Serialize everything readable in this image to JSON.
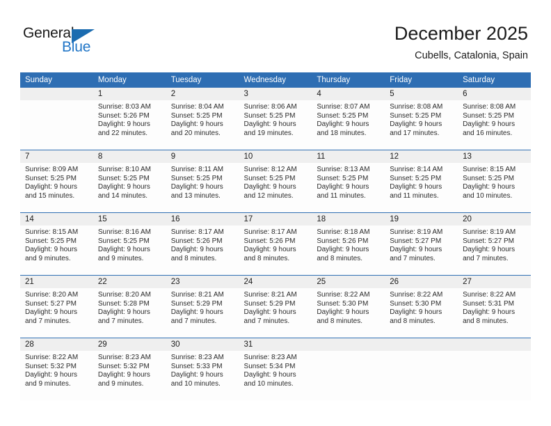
{
  "brand": {
    "name_top": "General",
    "name_bottom": "Blue",
    "accent_color": "#1b6cb0"
  },
  "header": {
    "title": "December 2025",
    "subtitle": "Cubells, Catalonia, Spain"
  },
  "theme": {
    "header_blue": "#2e6eb3",
    "daynum_gray": "#efefef",
    "cell_white": "#fdfdfd"
  },
  "weekday_headers": [
    "Sunday",
    "Monday",
    "Tuesday",
    "Wednesday",
    "Thursday",
    "Friday",
    "Saturday"
  ],
  "weeks": [
    [
      {
        "day": "",
        "sunrise": "",
        "sunset": "",
        "daylight_1": "",
        "daylight_2": ""
      },
      {
        "day": "1",
        "sunrise": "Sunrise: 8:03 AM",
        "sunset": "Sunset: 5:26 PM",
        "daylight_1": "Daylight: 9 hours",
        "daylight_2": "and 22 minutes."
      },
      {
        "day": "2",
        "sunrise": "Sunrise: 8:04 AM",
        "sunset": "Sunset: 5:25 PM",
        "daylight_1": "Daylight: 9 hours",
        "daylight_2": "and 20 minutes."
      },
      {
        "day": "3",
        "sunrise": "Sunrise: 8:06 AM",
        "sunset": "Sunset: 5:25 PM",
        "daylight_1": "Daylight: 9 hours",
        "daylight_2": "and 19 minutes."
      },
      {
        "day": "4",
        "sunrise": "Sunrise: 8:07 AM",
        "sunset": "Sunset: 5:25 PM",
        "daylight_1": "Daylight: 9 hours",
        "daylight_2": "and 18 minutes."
      },
      {
        "day": "5",
        "sunrise": "Sunrise: 8:08 AM",
        "sunset": "Sunset: 5:25 PM",
        "daylight_1": "Daylight: 9 hours",
        "daylight_2": "and 17 minutes."
      },
      {
        "day": "6",
        "sunrise": "Sunrise: 8:08 AM",
        "sunset": "Sunset: 5:25 PM",
        "daylight_1": "Daylight: 9 hours",
        "daylight_2": "and 16 minutes."
      }
    ],
    [
      {
        "day": "7",
        "sunrise": "Sunrise: 8:09 AM",
        "sunset": "Sunset: 5:25 PM",
        "daylight_1": "Daylight: 9 hours",
        "daylight_2": "and 15 minutes."
      },
      {
        "day": "8",
        "sunrise": "Sunrise: 8:10 AM",
        "sunset": "Sunset: 5:25 PM",
        "daylight_1": "Daylight: 9 hours",
        "daylight_2": "and 14 minutes."
      },
      {
        "day": "9",
        "sunrise": "Sunrise: 8:11 AM",
        "sunset": "Sunset: 5:25 PM",
        "daylight_1": "Daylight: 9 hours",
        "daylight_2": "and 13 minutes."
      },
      {
        "day": "10",
        "sunrise": "Sunrise: 8:12 AM",
        "sunset": "Sunset: 5:25 PM",
        "daylight_1": "Daylight: 9 hours",
        "daylight_2": "and 12 minutes."
      },
      {
        "day": "11",
        "sunrise": "Sunrise: 8:13 AM",
        "sunset": "Sunset: 5:25 PM",
        "daylight_1": "Daylight: 9 hours",
        "daylight_2": "and 11 minutes."
      },
      {
        "day": "12",
        "sunrise": "Sunrise: 8:14 AM",
        "sunset": "Sunset: 5:25 PM",
        "daylight_1": "Daylight: 9 hours",
        "daylight_2": "and 11 minutes."
      },
      {
        "day": "13",
        "sunrise": "Sunrise: 8:15 AM",
        "sunset": "Sunset: 5:25 PM",
        "daylight_1": "Daylight: 9 hours",
        "daylight_2": "and 10 minutes."
      }
    ],
    [
      {
        "day": "14",
        "sunrise": "Sunrise: 8:15 AM",
        "sunset": "Sunset: 5:25 PM",
        "daylight_1": "Daylight: 9 hours",
        "daylight_2": "and 9 minutes."
      },
      {
        "day": "15",
        "sunrise": "Sunrise: 8:16 AM",
        "sunset": "Sunset: 5:25 PM",
        "daylight_1": "Daylight: 9 hours",
        "daylight_2": "and 9 minutes."
      },
      {
        "day": "16",
        "sunrise": "Sunrise: 8:17 AM",
        "sunset": "Sunset: 5:26 PM",
        "daylight_1": "Daylight: 9 hours",
        "daylight_2": "and 8 minutes."
      },
      {
        "day": "17",
        "sunrise": "Sunrise: 8:17 AM",
        "sunset": "Sunset: 5:26 PM",
        "daylight_1": "Daylight: 9 hours",
        "daylight_2": "and 8 minutes."
      },
      {
        "day": "18",
        "sunrise": "Sunrise: 8:18 AM",
        "sunset": "Sunset: 5:26 PM",
        "daylight_1": "Daylight: 9 hours",
        "daylight_2": "and 8 minutes."
      },
      {
        "day": "19",
        "sunrise": "Sunrise: 8:19 AM",
        "sunset": "Sunset: 5:27 PM",
        "daylight_1": "Daylight: 9 hours",
        "daylight_2": "and 7 minutes."
      },
      {
        "day": "20",
        "sunrise": "Sunrise: 8:19 AM",
        "sunset": "Sunset: 5:27 PM",
        "daylight_1": "Daylight: 9 hours",
        "daylight_2": "and 7 minutes."
      }
    ],
    [
      {
        "day": "21",
        "sunrise": "Sunrise: 8:20 AM",
        "sunset": "Sunset: 5:27 PM",
        "daylight_1": "Daylight: 9 hours",
        "daylight_2": "and 7 minutes."
      },
      {
        "day": "22",
        "sunrise": "Sunrise: 8:20 AM",
        "sunset": "Sunset: 5:28 PM",
        "daylight_1": "Daylight: 9 hours",
        "daylight_2": "and 7 minutes."
      },
      {
        "day": "23",
        "sunrise": "Sunrise: 8:21 AM",
        "sunset": "Sunset: 5:29 PM",
        "daylight_1": "Daylight: 9 hours",
        "daylight_2": "and 7 minutes."
      },
      {
        "day": "24",
        "sunrise": "Sunrise: 8:21 AM",
        "sunset": "Sunset: 5:29 PM",
        "daylight_1": "Daylight: 9 hours",
        "daylight_2": "and 7 minutes."
      },
      {
        "day": "25",
        "sunrise": "Sunrise: 8:22 AM",
        "sunset": "Sunset: 5:30 PM",
        "daylight_1": "Daylight: 9 hours",
        "daylight_2": "and 8 minutes."
      },
      {
        "day": "26",
        "sunrise": "Sunrise: 8:22 AM",
        "sunset": "Sunset: 5:30 PM",
        "daylight_1": "Daylight: 9 hours",
        "daylight_2": "and 8 minutes."
      },
      {
        "day": "27",
        "sunrise": "Sunrise: 8:22 AM",
        "sunset": "Sunset: 5:31 PM",
        "daylight_1": "Daylight: 9 hours",
        "daylight_2": "and 8 minutes."
      }
    ],
    [
      {
        "day": "28",
        "sunrise": "Sunrise: 8:22 AM",
        "sunset": "Sunset: 5:32 PM",
        "daylight_1": "Daylight: 9 hours",
        "daylight_2": "and 9 minutes."
      },
      {
        "day": "29",
        "sunrise": "Sunrise: 8:23 AM",
        "sunset": "Sunset: 5:32 PM",
        "daylight_1": "Daylight: 9 hours",
        "daylight_2": "and 9 minutes."
      },
      {
        "day": "30",
        "sunrise": "Sunrise: 8:23 AM",
        "sunset": "Sunset: 5:33 PM",
        "daylight_1": "Daylight: 9 hours",
        "daylight_2": "and 10 minutes."
      },
      {
        "day": "31",
        "sunrise": "Sunrise: 8:23 AM",
        "sunset": "Sunset: 5:34 PM",
        "daylight_1": "Daylight: 9 hours",
        "daylight_2": "and 10 minutes."
      },
      {
        "day": "",
        "sunrise": "",
        "sunset": "",
        "daylight_1": "",
        "daylight_2": ""
      },
      {
        "day": "",
        "sunrise": "",
        "sunset": "",
        "daylight_1": "",
        "daylight_2": ""
      },
      {
        "day": "",
        "sunrise": "",
        "sunset": "",
        "daylight_1": "",
        "daylight_2": ""
      }
    ]
  ]
}
